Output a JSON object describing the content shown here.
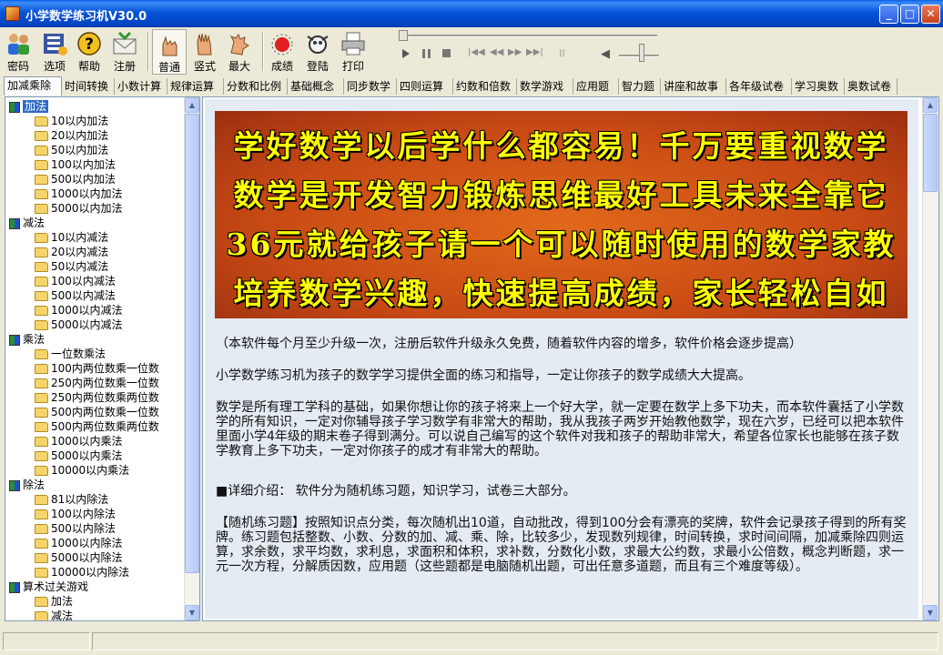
{
  "window": {
    "title": "小学数学练习机V30.0",
    "minimize": "_",
    "maximize": "□",
    "close": "✕"
  },
  "toolbar": {
    "buttons": [
      {
        "label": "密码",
        "icon": "users-icon"
      },
      {
        "label": "选项",
        "icon": "options-icon"
      },
      {
        "label": "帮助",
        "icon": "help-icon"
      },
      {
        "label": "注册",
        "icon": "register-mail-icon"
      },
      {
        "label": "普通",
        "icon": "hand-normal-icon",
        "pressed": true
      },
      {
        "label": "竖式",
        "icon": "hand-vertical-icon"
      },
      {
        "label": "最大",
        "icon": "hand-max-icon"
      },
      {
        "label": "成绩",
        "icon": "score-icon"
      },
      {
        "label": "登陆",
        "icon": "login-icon"
      },
      {
        "label": "打印",
        "icon": "printer-icon"
      }
    ]
  },
  "media": {
    "buttons": [
      "play-icon",
      "pause-icon",
      "stop-icon",
      "skip-back-icon",
      "rewind-icon",
      "forward-icon",
      "skip-forward-icon",
      "playlist-icon",
      "volume-icon"
    ]
  },
  "tabs": [
    "加减乘除",
    "时间转换",
    "小数计算",
    "规律运算",
    "分数和比例",
    "基础概念",
    "同步数学",
    "四则运算",
    "约数和倍数",
    "数学游戏",
    "应用题",
    "智力题",
    "讲座和故事",
    "各年级试卷",
    "学习奥数",
    "奥数试卷"
  ],
  "active_tab": 0,
  "tree": [
    {
      "type": "node",
      "label": "加法",
      "selected": true
    },
    {
      "type": "leaf",
      "label": "10以内加法"
    },
    {
      "type": "leaf",
      "label": "20以内加法"
    },
    {
      "type": "leaf",
      "label": "50以内加法"
    },
    {
      "type": "leaf",
      "label": "100以内加法"
    },
    {
      "type": "leaf",
      "label": "500以内加法"
    },
    {
      "type": "leaf",
      "label": "1000以内加法"
    },
    {
      "type": "leaf",
      "label": "5000以内加法"
    },
    {
      "type": "node",
      "label": "减法"
    },
    {
      "type": "leaf",
      "label": "10以内减法"
    },
    {
      "type": "leaf",
      "label": "20以内减法"
    },
    {
      "type": "leaf",
      "label": "50以内减法"
    },
    {
      "type": "leaf",
      "label": "100以内减法"
    },
    {
      "type": "leaf",
      "label": "500以内减法"
    },
    {
      "type": "leaf",
      "label": "1000以内减法"
    },
    {
      "type": "leaf",
      "label": "5000以内减法"
    },
    {
      "type": "node",
      "label": "乘法"
    },
    {
      "type": "leaf",
      "label": "一位数乘法"
    },
    {
      "type": "leaf",
      "label": "100内两位数乘一位数"
    },
    {
      "type": "leaf",
      "label": "250内两位数乘一位数"
    },
    {
      "type": "leaf",
      "label": "250内两位数乘两位数"
    },
    {
      "type": "leaf",
      "label": "500内两位数乘一位数"
    },
    {
      "type": "leaf",
      "label": "500内两位数乘两位数"
    },
    {
      "type": "leaf",
      "label": "1000以内乘法"
    },
    {
      "type": "leaf",
      "label": "5000以内乘法"
    },
    {
      "type": "leaf",
      "label": "10000以内乘法"
    },
    {
      "type": "node",
      "label": "除法"
    },
    {
      "type": "leaf",
      "label": "81以内除法"
    },
    {
      "type": "leaf",
      "label": "100以内除法"
    },
    {
      "type": "leaf",
      "label": "500以内除法"
    },
    {
      "type": "leaf",
      "label": "1000以内除法"
    },
    {
      "type": "leaf",
      "label": "5000以内除法"
    },
    {
      "type": "leaf",
      "label": "10000以内除法"
    },
    {
      "type": "node",
      "label": "算术过关游戏"
    },
    {
      "type": "leaf",
      "label": "加法"
    },
    {
      "type": "leaf",
      "label": "减法"
    }
  ],
  "banner": {
    "lines": [
      "学好数学以后学什么都容易！千万要重视数学",
      "数学是开发智力锻炼思维最好工具未来全靠它",
      "36元就给孩子请一个可以随时使用的数学家教",
      "培养数学兴趣，快速提高成绩，家长轻松自如"
    ]
  },
  "paragraphs": [
    "（本软件每个月至少升级一次，注册后软件升级永久免费，随着软件内容的增多，软件价格会逐步提高）",
    "小学数学练习机为孩子的数学学习提供全面的练习和指导，一定让你孩子的数学成绩大大提高。",
    "数学是所有理工学科的基础，如果你想让你的孩子将来上一个好大学，就一定要在数学上多下功夫，而本软件囊括了小学数学的所有知识，一定对你辅导孩子学习数学有非常大的帮助，我从我孩子两岁开始教他数学，现在六岁，已经可以把本软件里面小学4年级的期末卷子得到满分。可以说自己编写的这个软件对我和孩子的帮助非常大，希望各位家长也能够在孩子数学教育上多下功夫，一定对你孩子的成才有非常大的帮助。",
    "■详细介绍： 软件分为随机练习题，知识学习，试卷三大部分。",
    "【随机练习题】按照知识点分类，每次随机出10道，自动批改，得到100分会有漂亮的奖牌，软件会记录孩子得到的所有奖牌。练习题包括整数、小数、分数的加、减、乘、除，比较多少，发现数列规律，时间转换，求时间间隔，加减乘除四则运算，求余数，求平均数，求利息，求面积和体积，求补数，分数化小数，求最大公约数，求最小公倍数，概念判断题，求一元一次方程，分解质因数，应用题（这些题都是电脑随机出题，可出任意多道题，而且有三个难度等级）。"
  ],
  "status": {
    "pane1": "",
    "pane2": ""
  }
}
